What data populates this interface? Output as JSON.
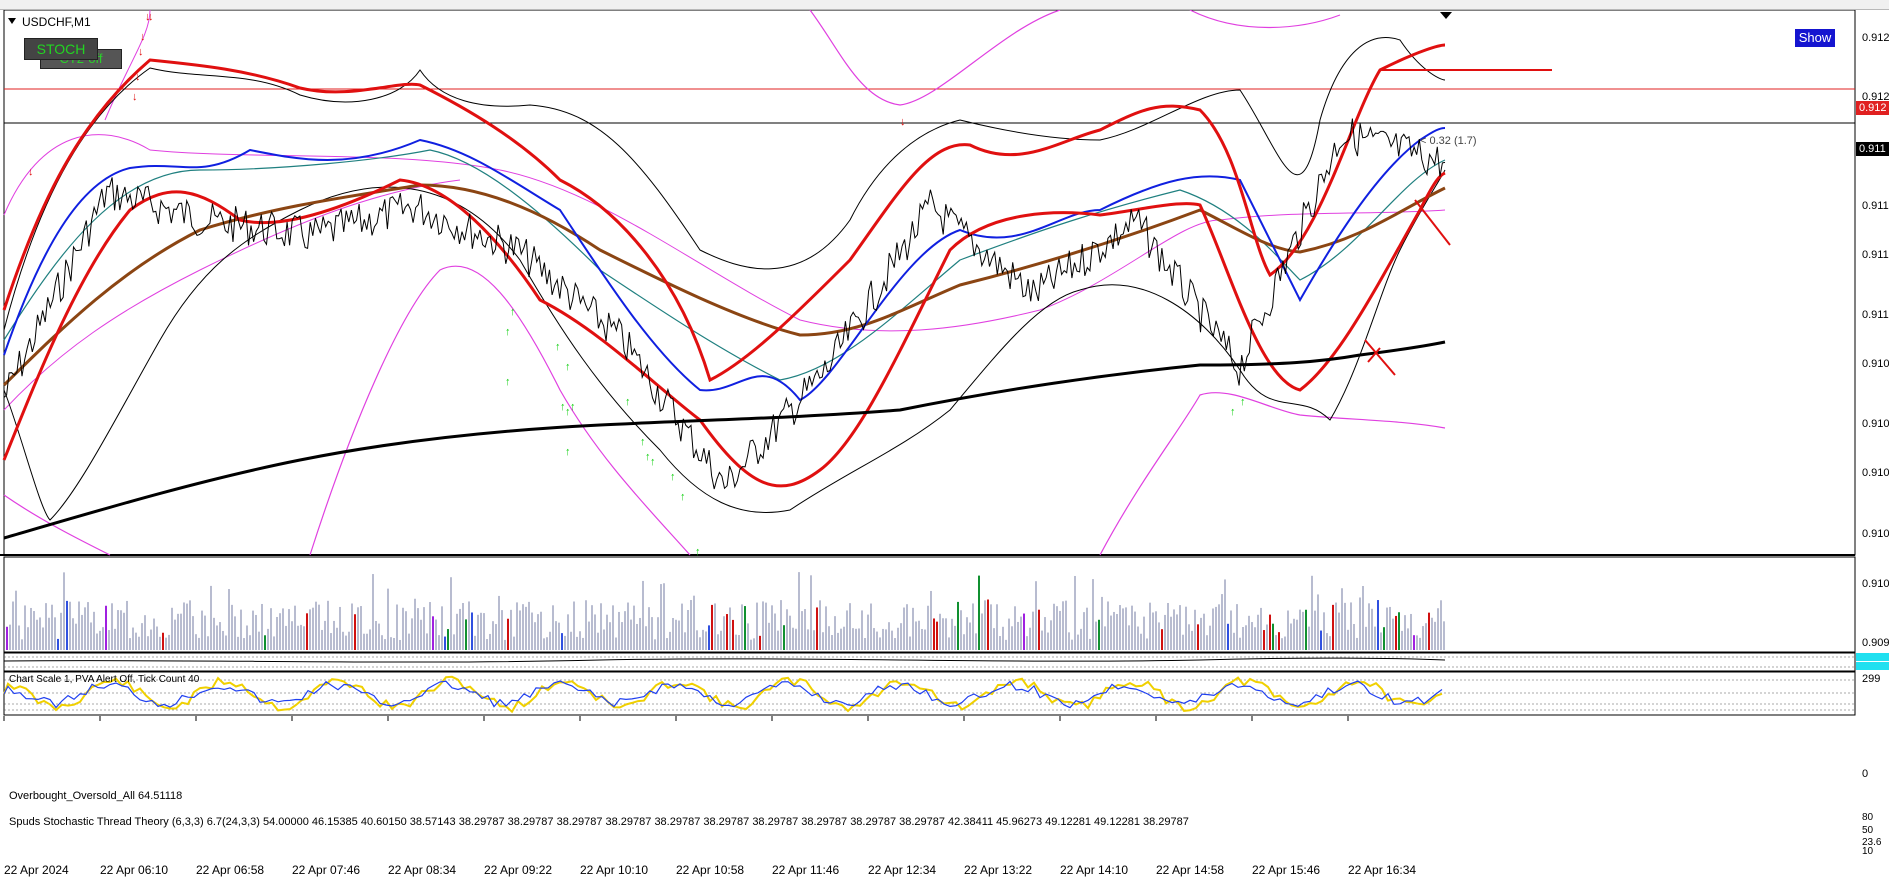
{
  "window": {
    "symbol_title": "USDCHF,M1"
  },
  "buttons": {
    "stoch": "STOCH",
    "ct": "CT2-off",
    "show": "Show"
  },
  "price_axis": {
    "labels": [
      "0.912",
      "0.912",
      "0.911",
      "0.911",
      "0.911",
      "0.910",
      "0.910",
      "0.910",
      "0.910",
      "0.910",
      "0.909"
    ],
    "bid_tag": "0.912",
    "ask_tag": "0.911",
    "bid_color": "#e02020",
    "ask_color": "#000000"
  },
  "spread_label": "< 0.32 (1.7)",
  "volume_panel": {
    "status_line": "Chart Scale  1,   PVA Alert Off,   Tick Count  40",
    "axis_top": "299",
    "axis_bottom": "0"
  },
  "obos_panel": {
    "label": "Overbought_Oversold_All 64.51118"
  },
  "stoch_panel": {
    "label": "Spuds Stochastic Thread Theory (6,3,3) 6.7(24,3,3) 54.00000 46.15385 40.60150 38.57143 38.29787 38.29787 38.29787 38.29787 38.29787 38.29787 38.29787 38.29787 38.29787 38.29787 42.38411 45.96273 49.12281 49.12281 38.29787",
    "axis_labels": [
      "80",
      "50",
      "23.6",
      "10"
    ]
  },
  "time_axis": [
    "22 Apr 2024",
    "22 Apr 06:10",
    "22 Apr 06:58",
    "22 Apr 07:46",
    "22 Apr 08:34",
    "22 Apr 09:22",
    "22 Apr 10:10",
    "22 Apr 10:58",
    "22 Apr 11:46",
    "22 Apr 12:34",
    "22 Apr 13:22",
    "22 Apr 14:10",
    "22 Apr 14:58",
    "22 Apr 15:46",
    "22 Apr 16:34"
  ],
  "colors": {
    "bollinger_outer": "#e040e0",
    "price": "#000000",
    "fast_ma_red": "#e01010",
    "blue_ma": "#1020e0",
    "teal_ma": "#208080",
    "brown_ma": "#8b4513",
    "long_ma": "#000000",
    "volume_default": "#b8bcd0",
    "volume_red": "#d01010",
    "volume_green": "#109030",
    "volume_blue": "#3050e0",
    "volume_purple": "#a020e0",
    "stoch_yellow": "#f0d000",
    "stoch_blue": "#2040f0"
  },
  "chart_data": {
    "type": "line",
    "symbol": "USDCHF",
    "timeframe": "M1",
    "x": [
      "22 Apr 2024",
      "22 Apr 06:10",
      "22 Apr 06:58",
      "22 Apr 07:46",
      "22 Apr 08:34",
      "22 Apr 09:22",
      "22 Apr 10:10",
      "22 Apr 10:58",
      "22 Apr 11:46",
      "22 Apr 12:34",
      "22 Apr 13:22",
      "22 Apr 14:10",
      "22 Apr 14:58",
      "22 Apr 15:46",
      "22 Apr 16:34"
    ],
    "series": [
      {
        "values": [
          0.91,
          0.9114,
          0.9112,
          0.9111,
          0.9113,
          0.911,
          0.9104,
          0.9094,
          0.9102,
          0.9113,
          0.9107,
          0.9112,
          0.9102,
          0.9118,
          0.9116
        ]
      },
      {
        "values": [
          0.9098,
          0.9113,
          0.9111,
          0.9111,
          0.9113,
          0.9108,
          0.9102,
          0.9097,
          0.9101,
          0.9109,
          0.9107,
          0.911,
          0.9105,
          0.9113,
          0.9113
        ]
      },
      {
        "values": [
          0.9092,
          0.9095,
          0.9097,
          0.9099,
          0.91,
          0.9101,
          0.9101,
          0.9101,
          0.9101,
          0.9101,
          0.9102,
          0.9103,
          0.9103,
          0.9103,
          0.9104
        ]
      }
    ],
    "ylim": [
      0.909,
      0.9125
    ],
    "grid": false,
    "legend": "none"
  }
}
